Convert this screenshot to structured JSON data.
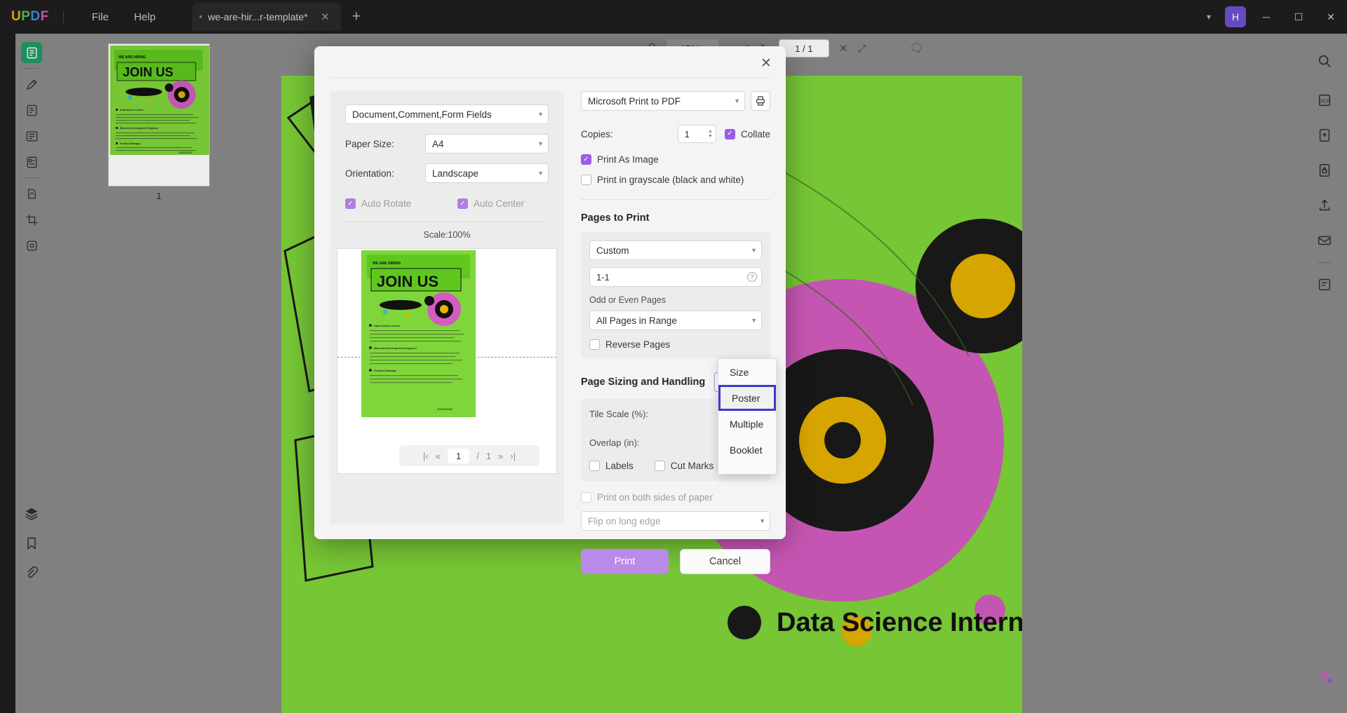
{
  "titlebar": {
    "logo": [
      {
        "ch": "U",
        "color": "#e8b200"
      },
      {
        "ch": "P",
        "color": "#4fbf5e"
      },
      {
        "ch": "D",
        "color": "#3b8fe0"
      },
      {
        "ch": "F",
        "color": "#d558b8"
      }
    ],
    "menus": [
      "File",
      "Help"
    ],
    "tab": {
      "title": "we-are-hir...r-template*",
      "close": "✕",
      "caret": "▾"
    },
    "new_tab": "+",
    "chevron": "▾",
    "avatar": "H",
    "window_buttons": [
      "─",
      "☐",
      "✕"
    ]
  },
  "left_rail": {
    "items": [
      {
        "name": "reader-icon",
        "active": true
      },
      {
        "name": "annotate-icon",
        "active": false
      },
      {
        "name": "edit-pdf-icon",
        "active": false
      },
      {
        "name": "organize-pages-icon",
        "active": false
      },
      {
        "name": "form-icon",
        "active": false
      },
      {
        "name": "convert-icon",
        "active": false
      },
      {
        "name": "crop-icon",
        "active": false
      },
      {
        "name": "protect-icon",
        "active": false
      }
    ],
    "bottom_items": [
      {
        "name": "layers-icon"
      },
      {
        "name": "bookmark-icon"
      },
      {
        "name": "attachment-icon"
      }
    ]
  },
  "right_rail": {
    "items": [
      {
        "name": "search-icon"
      },
      {
        "name": "ocr-icon"
      },
      {
        "name": "compress-icon"
      },
      {
        "name": "protect-icon"
      },
      {
        "name": "share-icon"
      },
      {
        "name": "mail-icon"
      },
      {
        "name": "minus-icon"
      },
      {
        "name": "batch-icon"
      }
    ],
    "bottom": {
      "name": "ai-assistant-icon"
    }
  },
  "thumbnail_panel": {
    "page_label": "1"
  },
  "viewer_toolbar": {
    "zoom_out": "−",
    "zoom_level": "170%",
    "zoom_in": "+",
    "page_indicator": "1 / 1",
    "search": "search-icon",
    "fit": "fit-icon",
    "rotate": "rotate-icon",
    "close": "✕",
    "comment": "comment-icon"
  },
  "document": {
    "heading": "WE ARE HIRING",
    "title": "JOIN US",
    "section": "Data Science Intern"
  },
  "print_dialog": {
    "close": "✕",
    "left": {
      "content_select": "Document,Comment,Form Fields",
      "paper_size_label": "Paper Size:",
      "paper_size_value": "A4",
      "orientation_label": "Orientation:",
      "orientation_value": "Landscape",
      "auto_rotate": {
        "label": "Auto Rotate",
        "checked": true,
        "disabled": true
      },
      "auto_center": {
        "label": "Auto Center",
        "checked": true,
        "disabled": true
      },
      "scale_text": "Scale:100%",
      "pagenav": {
        "first": "|‹",
        "prev": "«",
        "current": "1",
        "separator": "/",
        "total": "1",
        "next": "»",
        "last": "›|"
      }
    },
    "right": {
      "printer": "Microsoft Print to PDF",
      "printer_icon": "printer-icon",
      "copies_label": "Copies:",
      "copies_value": "1",
      "collate": {
        "label": "Collate",
        "checked": true
      },
      "print_as_image": {
        "label": "Print As Image",
        "checked": true
      },
      "print_grayscale": {
        "label": "Print in grayscale (black and white)",
        "checked": false
      },
      "pages_to_print_title": "Pages to Print",
      "pages_mode": "Custom",
      "page_range": "1-1",
      "range_help": "?",
      "odd_even_label": "Odd or Even Pages",
      "odd_even_value": "All Pages in Range",
      "reverse_pages": {
        "label": "Reverse Pages",
        "checked": false
      },
      "sizing_title": "Page Sizing and Handling",
      "sizing_value": "Poster",
      "tile_scale_label": "Tile Scale (%):",
      "overlap_label": "Overlap (in):",
      "labels_chk": {
        "label": "Labels",
        "checked": false
      },
      "cut_marks_chk": {
        "label": "Cut Marks",
        "checked": false
      },
      "both_sides": {
        "label": "Print on both sides of paper",
        "checked": false,
        "disabled": true
      },
      "flip_value": "Flip on long edge",
      "print_button": "Print",
      "cancel_button": "Cancel"
    },
    "sizing_dropdown": {
      "options": [
        "Size",
        "Poster",
        "Multiple",
        "Booklet"
      ],
      "selected_index": 1
    }
  },
  "colors": {
    "accent_purple": "#9b5de5",
    "print_button": "#b98ae8",
    "selection_blue": "#3b3bc9",
    "rail_active_green": "#1f9b63",
    "doc_green": "#7fd63a",
    "doc_magenta": "#d45cc0"
  }
}
